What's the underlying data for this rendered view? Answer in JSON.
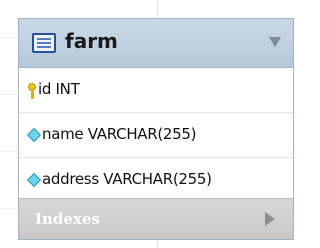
{
  "table": {
    "name": "farm",
    "icon": "table-icon",
    "collapse_icon": "triangle-down-icon",
    "header_color": "#c3d3e3",
    "columns": [
      {
        "label": "id INT",
        "icon": "primary-key-icon"
      },
      {
        "label": "name VARCHAR(255)",
        "icon": "column-diamond-icon"
      },
      {
        "label": "address VARCHAR(255)",
        "icon": "column-diamond-icon"
      }
    ],
    "indexes": {
      "label": "Indexes",
      "expand_icon": "triangle-right-icon"
    }
  }
}
